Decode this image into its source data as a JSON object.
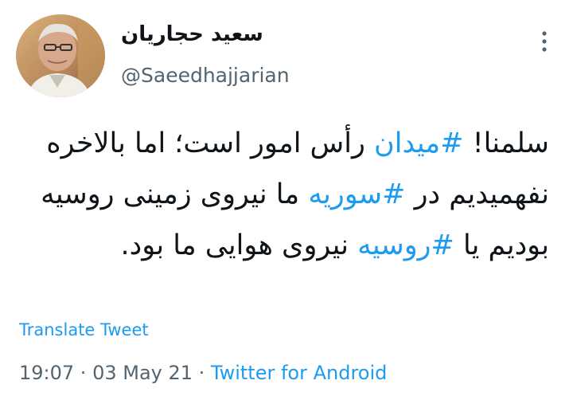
{
  "author": {
    "display_name": "سعید حجاریان",
    "handle": "@Saeedhajjarian"
  },
  "tweet": {
    "segments": [
      {
        "type": "text",
        "text": "سلمنا! "
      },
      {
        "type": "hashtag",
        "text": "#میدان"
      },
      {
        "type": "text",
        "text": " رأس امور است؛ اما بالاخره نفهمیدیم در "
      },
      {
        "type": "hashtag",
        "text": "#سوریه"
      },
      {
        "type": "text",
        "text": " ما نیروی زمینی روسیه بودیم یا "
      },
      {
        "type": "hashtag",
        "text": "#روسیه"
      },
      {
        "type": "text",
        "text": " نیروی هوایی ما بود."
      }
    ]
  },
  "translate_label": "Translate Tweet",
  "meta": {
    "time": "19:07",
    "separator": " · ",
    "date": "03 May 21",
    "source": "Twitter for Android"
  },
  "icons": {
    "more": "more-vertical-icon"
  },
  "colors": {
    "link": "#1d9bf0",
    "secondary_text": "#536471",
    "primary_text": "#0f1419"
  }
}
